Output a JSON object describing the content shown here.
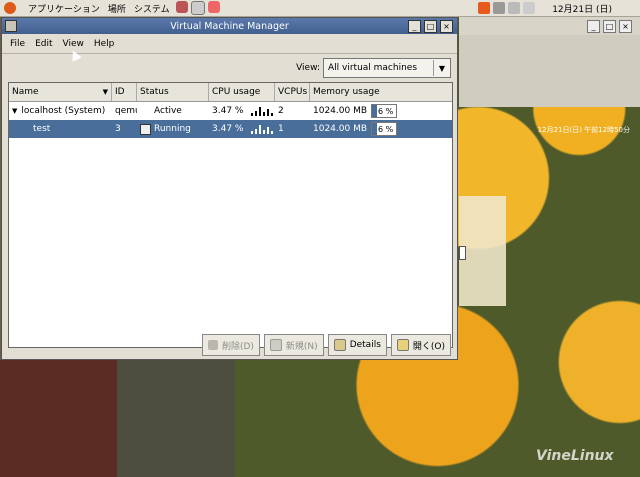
{
  "panel": {
    "menus": [
      "アプリケーション",
      "場所",
      "システム"
    ],
    "clock": "12月21日 (日)"
  },
  "desktop": {
    "watermark": "VineLinux",
    "second_window_clock": "12月21日(日) 午前12時50分"
  },
  "window": {
    "title": "Virtual Machine Manager",
    "menu": {
      "file": "File",
      "edit": "Edit",
      "view": "View",
      "help": "Help"
    },
    "view_filter": {
      "label": "View:",
      "value": "All virtual machines"
    },
    "columns": {
      "name": "Name",
      "id": "ID",
      "status": "Status",
      "cpu": "CPU usage",
      "vcpus": "VCPUs",
      "memory": "Memory usage"
    },
    "rows": [
      {
        "name": "localhost (System)",
        "id": "qemu",
        "status": "Active",
        "cpu": "3.47 %",
        "vcpus": "2",
        "memory": "1024.00 MB",
        "mem_pct": "6 %"
      },
      {
        "name": "test",
        "id": "3",
        "status": "Running",
        "cpu": "3.47 %",
        "vcpus": "1",
        "memory": "1024.00 MB",
        "mem_pct": "6 %"
      }
    ],
    "buttons": {
      "delete": "削除(D)",
      "new": "新規(N)",
      "details": "Details",
      "open": "開く(O)"
    }
  },
  "colors": {
    "title_bar": "#4a6898",
    "selection": "#496e9a"
  }
}
